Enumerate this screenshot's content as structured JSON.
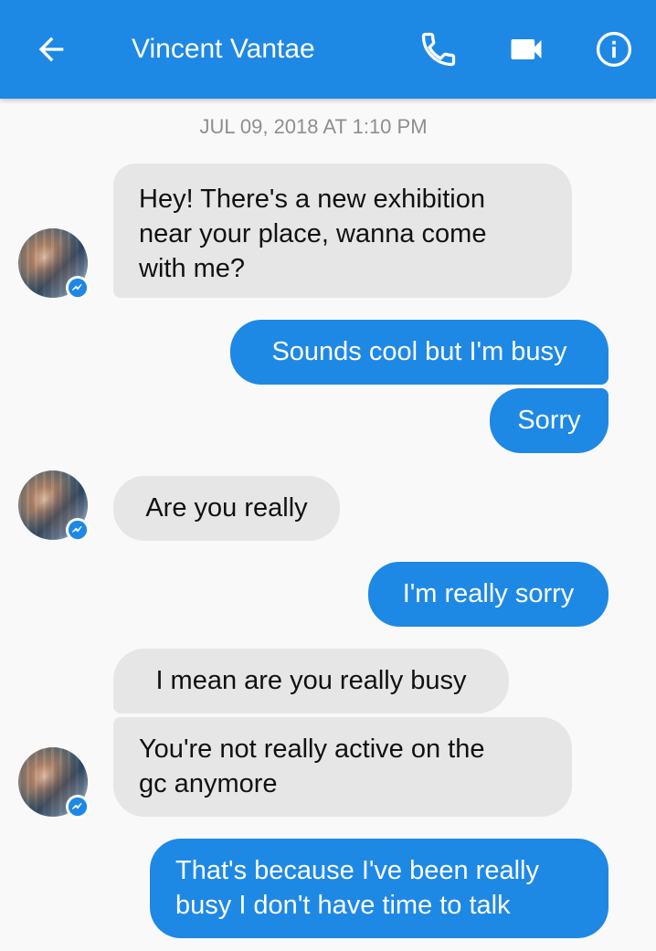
{
  "header": {
    "title": "Vincent Vantae",
    "back_icon": "arrow-left-icon",
    "call_icon": "phone-icon",
    "video_icon": "video-camera-icon",
    "info_icon": "info-icon",
    "background_color": "#1e88e5"
  },
  "timestamp": "JUL 09, 2018 AT 1:10 PM",
  "messages": [
    {
      "from": "Vincent Vantae",
      "lines": [
        "Hey! There's a new exhibition",
        "near your place, wanna come",
        "with me?"
      ]
    },
    {
      "from": "me",
      "text": "Sounds cool but I'm busy"
    },
    {
      "from": "me",
      "text": "Sorry"
    },
    {
      "from": "Vincent Vantae",
      "text": "Are you really"
    },
    {
      "from": "me",
      "text": "I'm really sorry"
    },
    {
      "from": "Vincent Vantae",
      "text": "I mean are you really busy"
    },
    {
      "from": "Vincent Vantae",
      "lines": [
        "You're not really active on the",
        "gc anymore"
      ]
    },
    {
      "from": "me",
      "lines": [
        "That's because I've been really",
        "busy I don't have time to talk"
      ]
    }
  ],
  "colors": {
    "outgoing_bubble": "#1e88e5",
    "incoming_bubble": "#e6e6e6",
    "messenger_badge": "#1e88e5"
  }
}
